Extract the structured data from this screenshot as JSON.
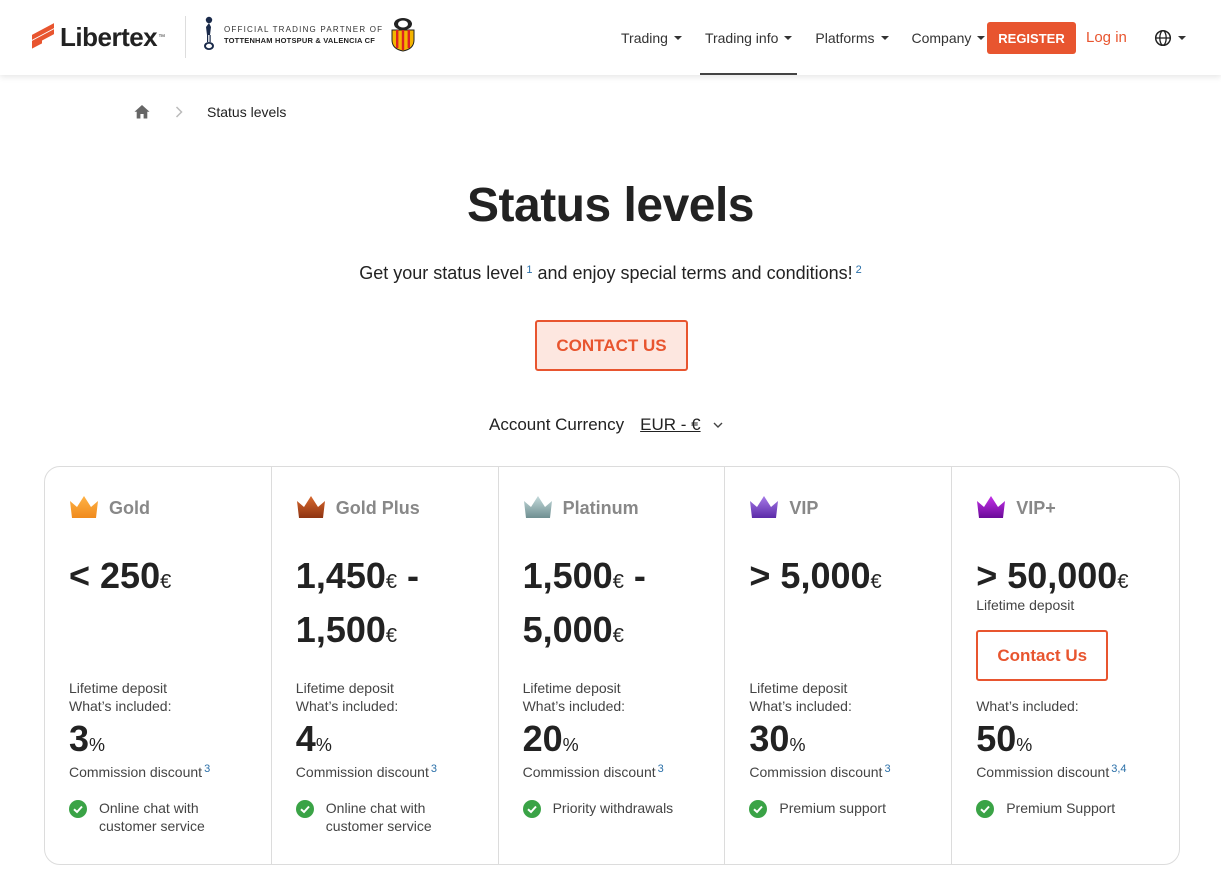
{
  "header": {
    "logo_text": "Libertex",
    "logo_tm": "™",
    "partner_line1": "OFFICIAL TRADING PARTNER OF",
    "partner_line2": "TOTTENHAM HOTSPUR & VALENCIA CF",
    "nav": [
      {
        "label": "Trading"
      },
      {
        "label": "Trading info"
      },
      {
        "label": "Platforms"
      },
      {
        "label": "Company"
      }
    ],
    "register_label": "REGISTER",
    "login_label": "Log in",
    "brand_color": "#e8552f"
  },
  "breadcrumb": {
    "current": "Status levels"
  },
  "hero": {
    "title": "Status levels",
    "subtitle_part1": "Get your status level",
    "sup1": "1",
    "subtitle_part2": " and enjoy special terms and conditions!",
    "sup2": "2",
    "contact_label": "CONTACT US"
  },
  "currency": {
    "label": "Account Currency",
    "selected": "EUR - €"
  },
  "levels": [
    {
      "name": "Gold",
      "crown_color": "#f08a1c",
      "amount_a": "< 250",
      "cur_a": "€",
      "amount_b": "",
      "cur_b": "",
      "lifetime": "Lifetime deposit",
      "included": "What’s included:",
      "pct": "3",
      "pct_sym": "%",
      "commission": "Commission discount",
      "commission_sup": "3",
      "feature": "Online chat with customer service"
    },
    {
      "name": "Gold Plus",
      "crown_color": "#a8421a",
      "amount_a": "1,450",
      "cur_a": "€",
      "amount_b": "1,500",
      "cur_b": "€",
      "lifetime": "Lifetime deposit",
      "included": "What’s included:",
      "pct": "4",
      "pct_sym": "%",
      "commission": "Commission discount",
      "commission_sup": "3",
      "feature": "Online chat with customer service"
    },
    {
      "name": "Platinum",
      "crown_color": "#7f9ea0",
      "amount_a": "1,500",
      "cur_a": "€",
      "amount_b": "5,000",
      "cur_b": "€",
      "lifetime": "Lifetime deposit",
      "included": "What’s included:",
      "pct": "20",
      "pct_sym": "%",
      "commission": "Commission discount",
      "commission_sup": "3",
      "feature": "Priority withdrawals"
    },
    {
      "name": "VIP",
      "crown_color": "#7b3fc9",
      "amount_a": "> 5,000",
      "cur_a": "€",
      "amount_b": "",
      "cur_b": "",
      "lifetime": "Lifetime deposit",
      "included": "What’s included:",
      "pct": "30",
      "pct_sym": "%",
      "commission": "Commission discount",
      "commission_sup": "3",
      "feature": "Premium support"
    },
    {
      "name": "VIP+",
      "crown_color": "#8b10b8",
      "amount_a": "> 50,000",
      "cur_a": "€",
      "amount_b": "",
      "cur_b": "",
      "lifetime": "Lifetime deposit",
      "included": "What’s included:",
      "contact_label": "Contact Us",
      "pct": "50",
      "pct_sym": "%",
      "commission": "Commission discount",
      "commission_sup": "3,4",
      "feature": "Premium Support"
    }
  ]
}
